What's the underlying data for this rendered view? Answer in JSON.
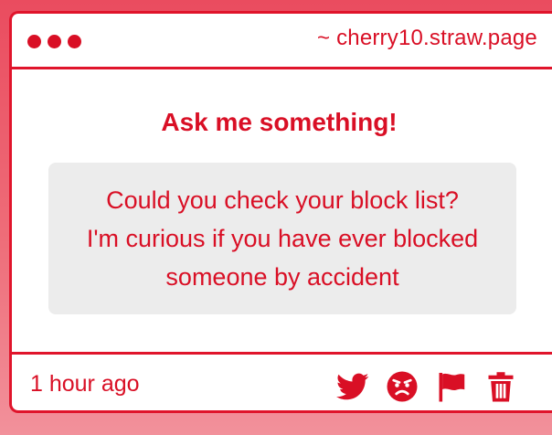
{
  "window": {
    "url": "~ cherry10.straw.page"
  },
  "main": {
    "heading": "Ask me something!",
    "question_lines": [
      "Could you check your block list?",
      "I'm curious if you have ever blocked",
      "someone by accident"
    ]
  },
  "footer": {
    "timestamp": "1 hour ago",
    "actions": [
      "twitter-icon",
      "angry-face-icon",
      "flag-icon",
      "trash-icon"
    ]
  },
  "colors": {
    "accent": "#d90f25",
    "background": "#ea4c5f",
    "question_box": "#ececec"
  }
}
